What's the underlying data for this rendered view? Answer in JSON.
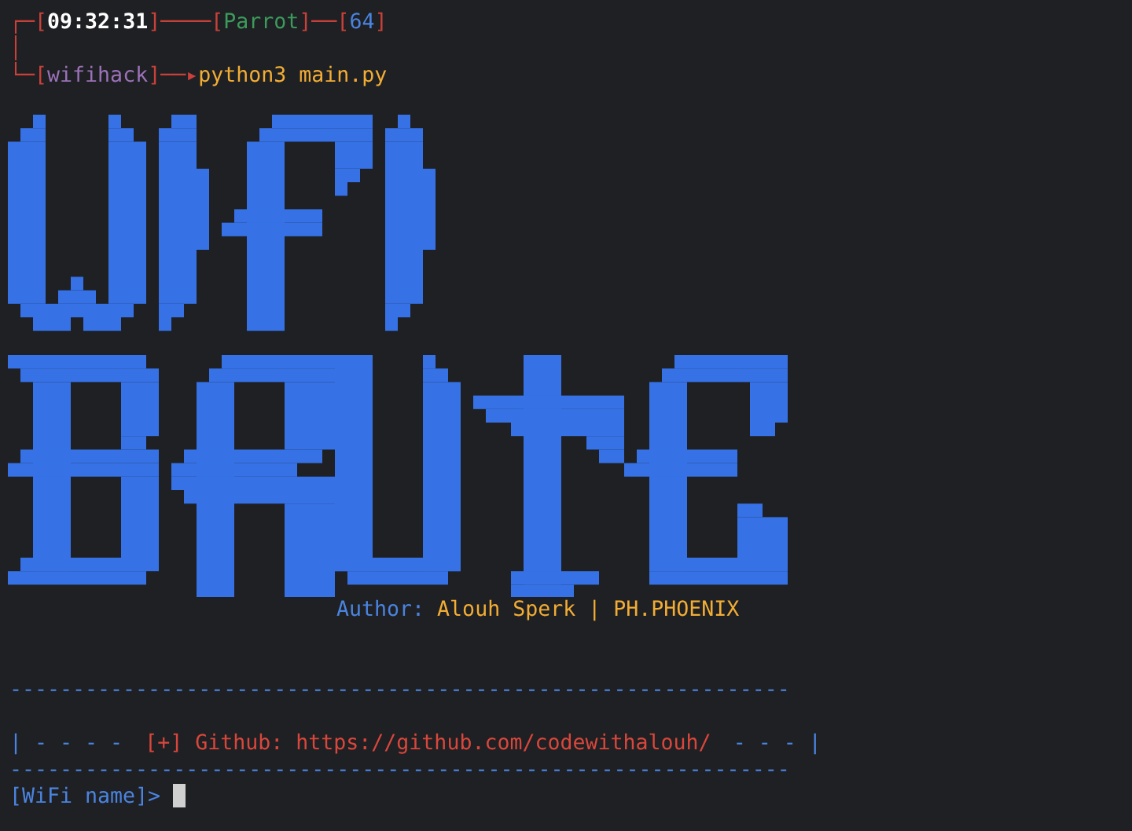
{
  "prompt_lines": [
    {
      "segments": [
        {
          "kind": "frame",
          "text": "┌─["
        },
        {
          "kind": "time",
          "text": "09:32:31"
        },
        {
          "kind": "frame",
          "text": "]────["
        },
        {
          "kind": "host",
          "text": "Parrot"
        },
        {
          "kind": "frame",
          "text": "]──["
        },
        {
          "kind": "number",
          "text": "64"
        },
        {
          "kind": "frame",
          "text": "]"
        }
      ]
    },
    {
      "segments": [
        {
          "kind": "frame",
          "text": "│"
        }
      ]
    },
    {
      "segments": [
        {
          "kind": "frame",
          "text": "└─["
        },
        {
          "kind": "directory",
          "text": "wifihack"
        },
        {
          "kind": "frame",
          "text": "]──▸"
        },
        {
          "kind": "command",
          "text": "python3 main.py"
        }
      ]
    }
  ],
  "author": {
    "label": "Author:",
    "name": "Alouh Sperk | PH.PHOENIX"
  },
  "divider_top": "--------------------------------------------------------------",
  "github_line": {
    "left": "| - - - -",
    "text": "[+] Github: https://github.com/codewithalouh/",
    "right": "- - - |"
  },
  "divider_bottom": "--------------------------------------------------------------",
  "input": {
    "prompt": "[WiFi name]>"
  }
}
